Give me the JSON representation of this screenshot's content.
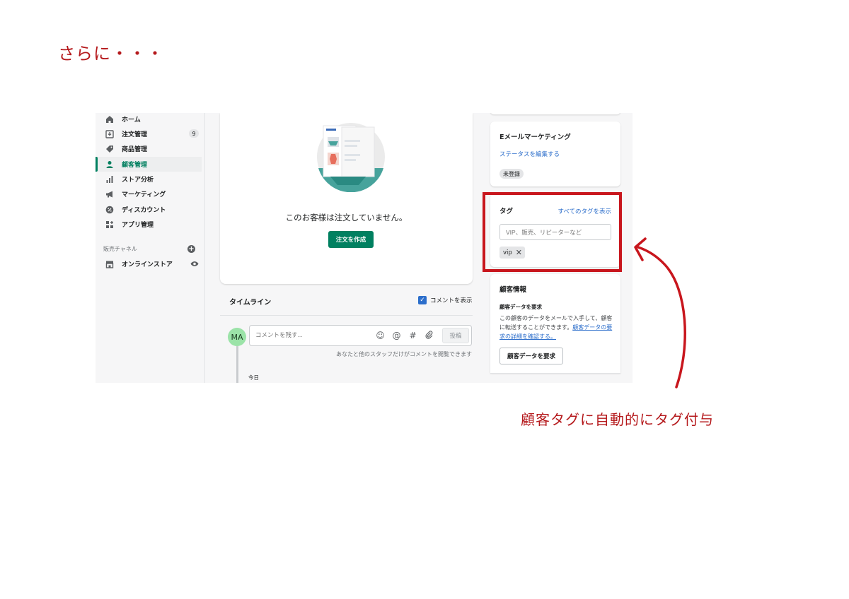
{
  "slide": {
    "title": "さらに・・・",
    "caption": "顧客タグに自動的にタグ付与"
  },
  "sidebar": {
    "items": [
      {
        "label": "ホーム",
        "icon": "home-icon"
      },
      {
        "label": "注文管理",
        "icon": "orders-icon",
        "badge": "9"
      },
      {
        "label": "商品管理",
        "icon": "tag-icon"
      },
      {
        "label": "顧客管理",
        "icon": "person-icon",
        "active": true
      },
      {
        "label": "ストア分析",
        "icon": "bar-chart-icon"
      },
      {
        "label": "マーケティング",
        "icon": "megaphone-icon"
      },
      {
        "label": "ディスカウント",
        "icon": "discount-icon"
      },
      {
        "label": "アプリ管理",
        "icon": "apps-icon"
      }
    ],
    "channels_label": "販売チャネル",
    "online_store_label": "オンラインストア"
  },
  "orders_empty": {
    "message": "このお客様は注文していません。",
    "create_button": "注文を作成"
  },
  "timeline": {
    "title": "タイムライン",
    "show_comments_label": "コメントを表示",
    "avatar_initials": "MA",
    "comment_placeholder": "コメントを残す...",
    "post_button": "投稿",
    "note": "あなたと他のスタッフだけがコメントを閲覧できます",
    "today_label": "今日"
  },
  "email_marketing": {
    "title": "Eメールマーケティング",
    "edit_status_link": "ステータスを編集する",
    "status": "未登録"
  },
  "tags": {
    "title": "タグ",
    "view_all_link": "すべてのタグを表示",
    "input_placeholder": "VIP、販売、リピーターなど",
    "chips": [
      "vip"
    ]
  },
  "customer_info": {
    "title": "顧客情報",
    "request_subtitle": "顧客データを要求",
    "description": "この顧客のデータをメールで入手して、顧客に転送することができます。",
    "description_link": "顧客データの要求の詳細を確認する。",
    "request_button": "顧客データを要求"
  },
  "colors": {
    "annotation_red": "#c8161d",
    "primary_green": "#008060",
    "link_blue": "#2c6ecb"
  }
}
